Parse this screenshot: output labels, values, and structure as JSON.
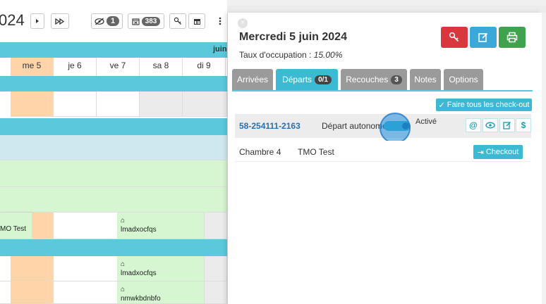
{
  "toolbar": {
    "year_fragment": "024",
    "hidden_count": "1",
    "calendar_count": "383"
  },
  "calendar": {
    "month_label": "juin",
    "days": [
      "me 5",
      "je 6",
      "ve 7",
      "sa 8",
      "di 9"
    ],
    "reservations": {
      "tmo": "MO Test",
      "r1": "lmadxocfqs",
      "r2": "lmadxocfqs",
      "r3": "nmwkbdnbfo"
    }
  },
  "panel": {
    "title": "Mercredi 5 juin 2024",
    "occupancy_label": "Taux d'occupation :",
    "occupancy_value": "15.00%",
    "tabs": [
      {
        "label": "Arrivées"
      },
      {
        "label": "Départs",
        "count": "0/1"
      },
      {
        "label": "Recouches",
        "count": "3"
      },
      {
        "label": "Notes"
      },
      {
        "label": "Options"
      }
    ],
    "check_all_label": "Faire tous les check-out",
    "departure": {
      "reservation_number": "58-254111-2163",
      "autonomous_label": "Départ autonome :",
      "status_label": "Activé",
      "room": "Chambre 4",
      "guest": "TMO Test",
      "checkout_label": "Checkout"
    },
    "action_icons": [
      "at-icon",
      "eye-icon",
      "edit-icon",
      "dollar-icon"
    ]
  },
  "colors": {
    "cyan": "#5bc8dc",
    "tab_active": "#3cbad3",
    "peach": "#ffd4a8",
    "light_green": "#d6f5d1",
    "red": "#d9363e",
    "blue": "#3aa9d9",
    "green": "#3fa34d",
    "link_blue": "#2a6fb0"
  }
}
